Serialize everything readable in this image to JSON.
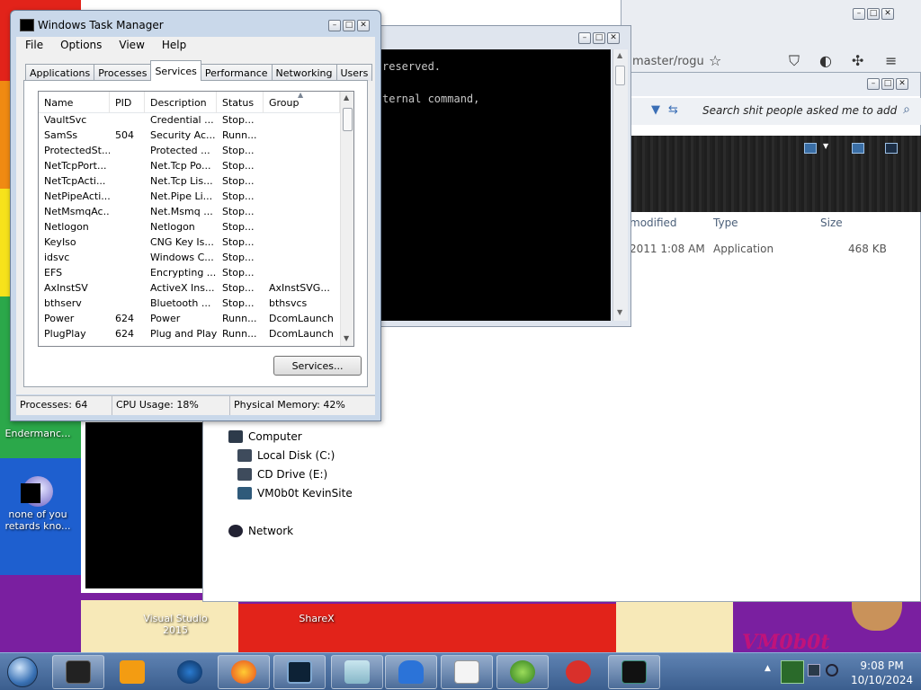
{
  "taskmanager": {
    "title": "Windows Task Manager",
    "menus": [
      "File",
      "Options",
      "View",
      "Help"
    ],
    "tabs": [
      "Applications",
      "Processes",
      "Services",
      "Performance",
      "Networking",
      "Users"
    ],
    "active_tab": "Services",
    "columns": [
      "Name",
      "PID",
      "Description",
      "Status",
      "Group"
    ],
    "rows": [
      [
        "VaultSvc",
        "",
        "Credential ...",
        "Stop...",
        ""
      ],
      [
        "SamSs",
        "504",
        "Security Ac...",
        "Runn...",
        ""
      ],
      [
        "ProtectedSt...",
        "",
        "Protected ...",
        "Stop...",
        ""
      ],
      [
        "NetTcpPort...",
        "",
        "Net.Tcp Po...",
        "Stop...",
        ""
      ],
      [
        "NetTcpActi...",
        "",
        "Net.Tcp Lis...",
        "Stop...",
        ""
      ],
      [
        "NetPipeActi...",
        "",
        "Net.Pipe Li...",
        "Stop...",
        ""
      ],
      [
        "NetMsmqAc...",
        "",
        "Net.Msmq ...",
        "Stop...",
        ""
      ],
      [
        "Netlogon",
        "",
        "Netlogon",
        "Stop...",
        ""
      ],
      [
        "KeyIso",
        "",
        "CNG Key Is...",
        "Stop...",
        ""
      ],
      [
        "idsvc",
        "",
        "Windows C...",
        "Stop...",
        ""
      ],
      [
        "EFS",
        "",
        "Encrypting ...",
        "Stop...",
        ""
      ],
      [
        "AxInstSV",
        "",
        "ActiveX Ins...",
        "Stop...",
        "AxInstSVG..."
      ],
      [
        "bthserv",
        "",
        "Bluetooth ...",
        "Stop...",
        "bthsvcs"
      ],
      [
        "Power",
        "624",
        "Power",
        "Runn...",
        "DcomLaunch"
      ],
      [
        "PlugPlay",
        "624",
        "Plug and Play",
        "Runn...",
        "DcomLaunch"
      ]
    ],
    "services_button": "Services...",
    "status": {
      "processes": "Processes: 64",
      "cpu": "CPU Usage: 18%",
      "memory": "Physical Memory: 42%"
    }
  },
  "console": {
    "line1": "reserved.",
    "line2": "ternal command,"
  },
  "browser": {
    "url_fragment": "master/rogu"
  },
  "explorer": {
    "search_placeholder": "Search shit people asked me to add",
    "columns": [
      "modified",
      "Type",
      "Size"
    ],
    "file_row": {
      "modified": "2011 1:08 AM",
      "type": "Application",
      "size": "468 KB"
    },
    "nav_items": [
      "Computer",
      "Local Disk (C:)",
      "CD Drive (E:)",
      "VM0b0t KevinSite",
      "Network"
    ]
  },
  "desktop": {
    "icons": [
      "Endermanc...",
      "none of you retards kno...",
      "Visual Studio 2015",
      "ShareX"
    ],
    "watermark": "VM0b0t",
    "colors": {
      "red": "#e2231a",
      "orange": "#f08a12",
      "yellow": "#f7e21b",
      "green": "#2ba84a",
      "blue": "#1e5fcf",
      "purple": "#7a1fa0"
    }
  },
  "taskbar": {
    "time": "9:08 PM",
    "date": "10/10/2024"
  }
}
